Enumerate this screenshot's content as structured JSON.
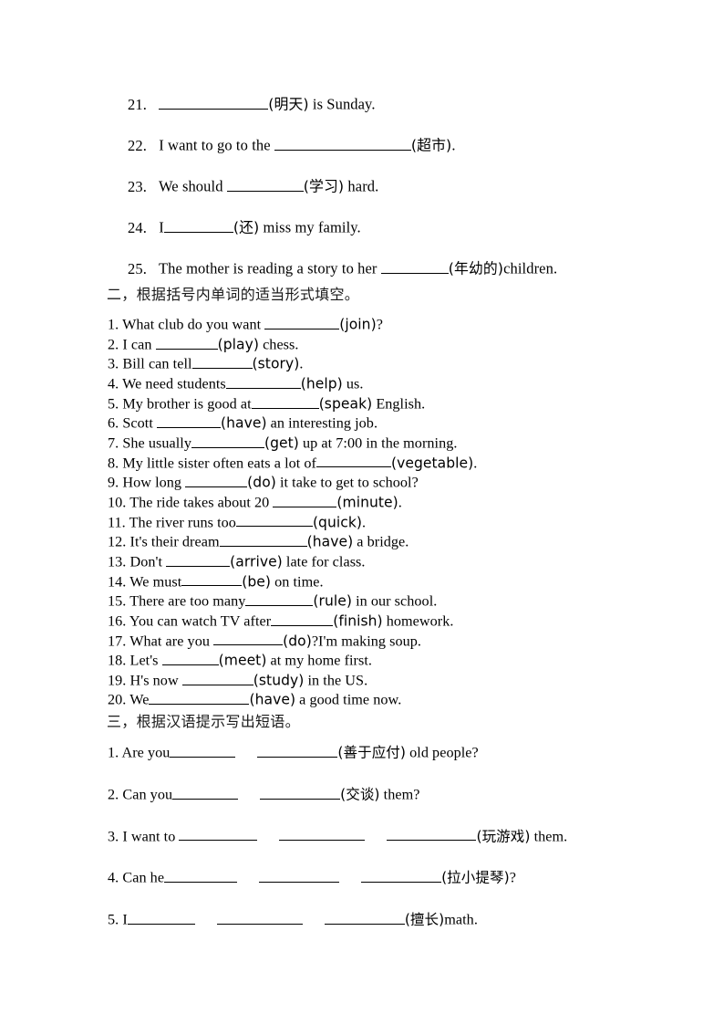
{
  "document": {
    "type": "worksheet",
    "language": "en-zh",
    "background_color": "#ffffff",
    "text_color": "#000000"
  },
  "section_one": {
    "items": [
      {
        "number": "21.",
        "before": "",
        "blank_1": 120,
        "hint": "(明天)",
        "after": " is Sunday."
      },
      {
        "number": "22.",
        "before": "I want to go to the ",
        "blank_1": 150,
        "hint": "(超市)",
        "after": "."
      },
      {
        "number": "23.",
        "before": "We should ",
        "blank_1": 84,
        "hint": "(学习)",
        "after": " hard."
      },
      {
        "number": "24.",
        "before": "I",
        "blank_1": 76,
        "hint": "(还)",
        "after": " miss my family."
      },
      {
        "number": "25.",
        "before": "The mother is reading a story to her ",
        "blank_1": 74,
        "hint": "(年幼的)",
        "after": "children."
      }
    ]
  },
  "section_two": {
    "heading": "二，根据括号内单词的适当形式填空。",
    "items": [
      {
        "number": "1.",
        "before": "What club do you want ",
        "blank_1": 82,
        "hint": "(join)",
        "after": "?"
      },
      {
        "number": "2.",
        "before": "I can ",
        "blank_1": 68,
        "hint": "(play)",
        "after": " chess."
      },
      {
        "number": "3.",
        "before": "Bill can tell",
        "blank_1": 66,
        "hint": "(story)",
        "after": "."
      },
      {
        "number": "4.",
        "before": "We need students",
        "blank_1": 82,
        "hint": "(help)",
        "after": " us."
      },
      {
        "number": "5.",
        "before": "My brother is good at",
        "blank_1": 74,
        "hint": "(speak)",
        "after": " English."
      },
      {
        "number": "6.",
        "before": "Scott ",
        "blank_1": 70,
        "hint": "(have)",
        "after": " an interesting job."
      },
      {
        "number": "7.",
        "before": "She usually",
        "blank_1": 80,
        "hint": "(get)",
        "after": " up at 7:00 in the morning."
      },
      {
        "number": "8.",
        "before": "My little sister often eats a lot of",
        "blank_1": 82,
        "hint": "(vegetable)",
        "after": "."
      },
      {
        "number": "9.",
        "before": "How long ",
        "blank_1": 68,
        "hint": "(do)",
        "after": " it take to get to school?"
      },
      {
        "number": "10.",
        "before": "The ride takes about 20 ",
        "blank_1": 70,
        "hint": "(minute)",
        "after": "."
      },
      {
        "number": "11.",
        "before": "The river runs too",
        "blank_1": 84,
        "hint": "(quick)",
        "after": "."
      },
      {
        "number": "12.",
        "before": "It's their dream",
        "blank_1": 96,
        "hint": "(have)",
        "after": " a bridge."
      },
      {
        "number": "13.",
        "before": "Don't ",
        "blank_1": 70,
        "hint": "(arrive)",
        "after": " late for class."
      },
      {
        "number": "14.",
        "before": "We must",
        "blank_1": 66,
        "hint": "(be)",
        "after": " on time."
      },
      {
        "number": "15.",
        "before": "There are too many",
        "blank_1": 74,
        "hint": "(rule)",
        "after": " in our school."
      },
      {
        "number": "16.",
        "before": "You can watch TV after",
        "blank_1": 68,
        "hint": "(finish)",
        "after": " homework."
      },
      {
        "number": "17.",
        "before": "What are you ",
        "blank_1": 76,
        "hint": "(do)",
        "after": "?I'm making soup."
      },
      {
        "number": "18.",
        "before": "Let's ",
        "blank_1": 62,
        "hint": "(meet)",
        "after": " at my home first."
      },
      {
        "number": "19.",
        "before": "H's now ",
        "blank_1": 78,
        "hint": "(study)",
        "after": " in the US."
      },
      {
        "number": "20.",
        "before": "We",
        "blank_1": 110,
        "hint": "(have)",
        "after": " a good time now."
      }
    ]
  },
  "section_three": {
    "heading": "三，根据汉语提示写出短语。",
    "items": [
      {
        "number": "1.",
        "before": "Are you",
        "blank_1": 72,
        "gap_1": 24,
        "blank_2": 88,
        "blank_3": 0,
        "hint": "(善于应付)",
        "after": " old people?"
      },
      {
        "number": "2.",
        "before": "Can you",
        "blank_1": 72,
        "gap_1": 24,
        "blank_2": 88,
        "blank_3": 0,
        "hint": "(交谈)",
        "after": " them?"
      },
      {
        "number": "3.",
        "before": "I want to ",
        "blank_1": 86,
        "gap_1": 24,
        "blank_2": 94,
        "gap_2": 24,
        "blank_3": 98,
        "hint": "(玩游戏)",
        "after": " them."
      },
      {
        "number": "4.",
        "before": "Can he",
        "blank_1": 80,
        "gap_1": 24,
        "blank_2": 88,
        "gap_2": 24,
        "blank_3": 88,
        "hint": "(拉小提琴)",
        "after": "?"
      },
      {
        "number": "5.",
        "before": "I",
        "blank_1": 74,
        "gap_1": 24,
        "blank_2": 94,
        "gap_2": 24,
        "blank_3": 88,
        "hint": "(擅长)",
        "after": "math."
      }
    ]
  }
}
